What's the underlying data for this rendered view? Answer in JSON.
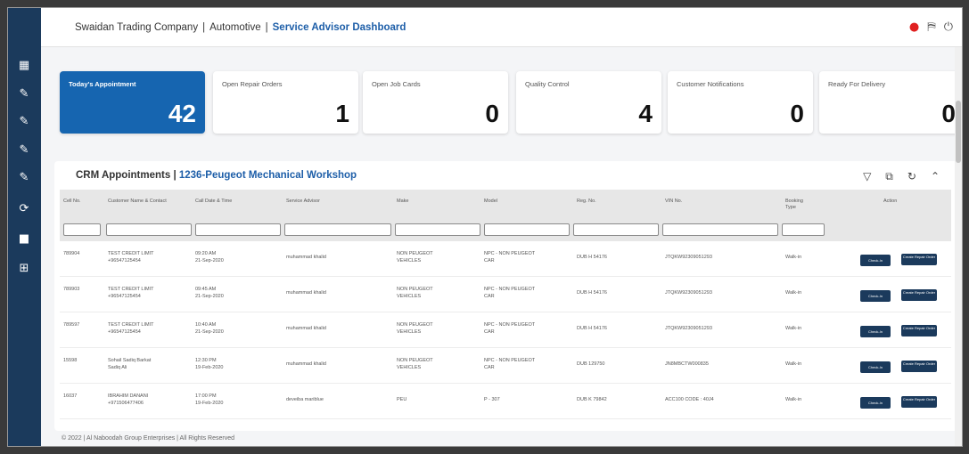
{
  "header": {
    "company": "Swaidan Trading Company",
    "division": "Automotive",
    "page": "Service Advisor Dashboard",
    "icons": [
      "notification-bell-icon",
      "language-icon",
      "power-icon"
    ]
  },
  "sidebar": {
    "items": [
      "dashboard-icon",
      "wrench-icon",
      "wrench-icon",
      "wrench-icon",
      "wrench-icon",
      "refresh-icon",
      "folder-icon",
      "grid-icon"
    ]
  },
  "cards": [
    {
      "label": "Today's Appointment",
      "value": "42"
    },
    {
      "label": "Open Repair Orders",
      "value": "1"
    },
    {
      "label": "Open Job Cards",
      "value": "0"
    },
    {
      "label": "Quality Control",
      "value": "4"
    },
    {
      "label": "Customer Notifications",
      "value": "0"
    },
    {
      "label": "Ready For Delivery",
      "value": "0"
    }
  ],
  "panel": {
    "title": "CRM Appointments",
    "workshop": "1236-Peugeot Mechanical Workshop",
    "tools": [
      "filter-icon",
      "export-icon",
      "refresh-icon",
      "collapse-icon"
    ]
  },
  "table": {
    "columns": [
      "Cell No.",
      "Customer Name & Contact",
      "Call Date & Time",
      "Service Advisor",
      "Make",
      "Model",
      "Reg. No.",
      "VIN No.",
      "Booking Type",
      "Action"
    ],
    "rows": [
      {
        "id": "789904",
        "customer": "TEST CREDIT LIMIT",
        "phone": "+96547125454",
        "time": "09:20 AM",
        "date": "21-Sep-2020",
        "advisor": "muhammad khalid",
        "make": "NON PEUGEOT",
        "make2": "VEHICLES",
        "model": "NPC - NON PEUGEOT",
        "model2": "CAR",
        "reg": "DUB H 54176",
        "vin": "JTQKW92309051293",
        "type": "Walk-in"
      },
      {
        "id": "789903",
        "customer": "TEST CREDIT LIMIT",
        "phone": "+96547125454",
        "time": "09:45 AM",
        "date": "21-Sep-2020",
        "advisor": "muhammad khalid",
        "make": "NON PEUGEOT",
        "make2": "VEHICLES",
        "model": "NPC - NON PEUGEOT",
        "model2": "CAR",
        "reg": "DUB H 54176",
        "vin": "JTQKW92309051293",
        "type": "Walk-in"
      },
      {
        "id": "789597",
        "customer": "TEST CREDIT LIMIT",
        "phone": "+96547125454",
        "time": "10:40 AM",
        "date": "21-Sep-2020",
        "advisor": "muhammad khalid",
        "make": "NON PEUGEOT",
        "make2": "VEHICLES",
        "model": "NPC - NON PEUGEOT",
        "model2": "CAR",
        "reg": "DUB H 54176",
        "vin": "JTQKW92309051293",
        "type": "Walk-in"
      },
      {
        "id": "15598",
        "customer": "Sohail Sadiq Barkat",
        "phone": "Sadiq Ali",
        "time": "12:30 PM",
        "date": "19-Feb-2020",
        "advisor": "muhammad khalid",
        "make": "NON PEUGEOT",
        "make2": "VEHICLES",
        "model": "NPC - NON PEUGEOT",
        "model2": "CAR",
        "reg": "DUB 129750",
        "vin": "JN8MBCTW000835",
        "type": "Walk-in"
      },
      {
        "id": "16037",
        "customer": "IBRAHIM DANANI",
        "phone": "+971506477406",
        "time": "17:00 PM",
        "date": "19-Feb-2020",
        "advisor": "deveiba mariblue",
        "make": "PEU",
        "make2": "",
        "model": "P - 307",
        "model2": "",
        "reg": "DUB K 79842",
        "vin": "ACC100 CODE : 40J4",
        "type": "Walk-in"
      }
    ],
    "actions": [
      "Check-In",
      "Create Repair Order"
    ]
  },
  "footer": {
    "text": "© 2022 | Al Naboodah Group Enterprises | All Rights Reserved"
  }
}
